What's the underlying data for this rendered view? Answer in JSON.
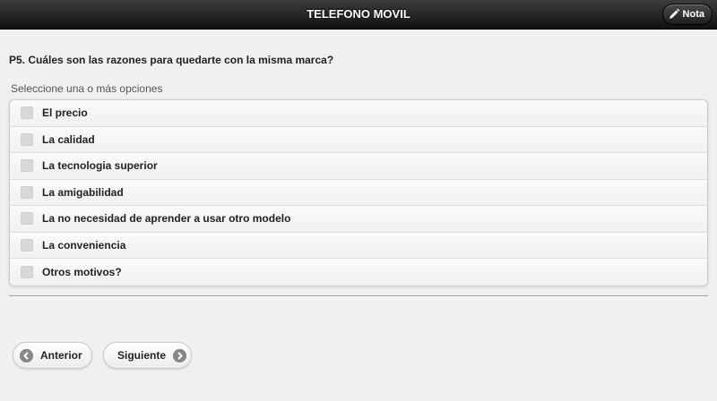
{
  "header": {
    "title": "TELEFONO MOVIL",
    "note_button_label": "Nota",
    "note_icon": "pencil-icon"
  },
  "question": {
    "text": "P5. Cuáles son las razones para quedarte con la misma marca?",
    "hint": "Seleccione una o más opciones"
  },
  "options": [
    {
      "label": "El precio",
      "checked": false
    },
    {
      "label": "La calidad",
      "checked": false
    },
    {
      "label": "La tecnologia superior",
      "checked": false
    },
    {
      "label": "La amigabilidad",
      "checked": false
    },
    {
      "label": "La no necesidad de aprender a usar otro modelo",
      "checked": false
    },
    {
      "label": "La conveniencia",
      "checked": false
    },
    {
      "label": "Otros motivos?",
      "checked": false
    }
  ],
  "navigation": {
    "prev_label": "Anterior",
    "prev_icon": "arrow-left-icon",
    "next_label": "Siguiente",
    "next_icon": "arrow-right-icon"
  },
  "colors": {
    "header_bg": "#1e1e1e",
    "page_bg": "#f0f0f0",
    "icon_gray": "#888888"
  }
}
